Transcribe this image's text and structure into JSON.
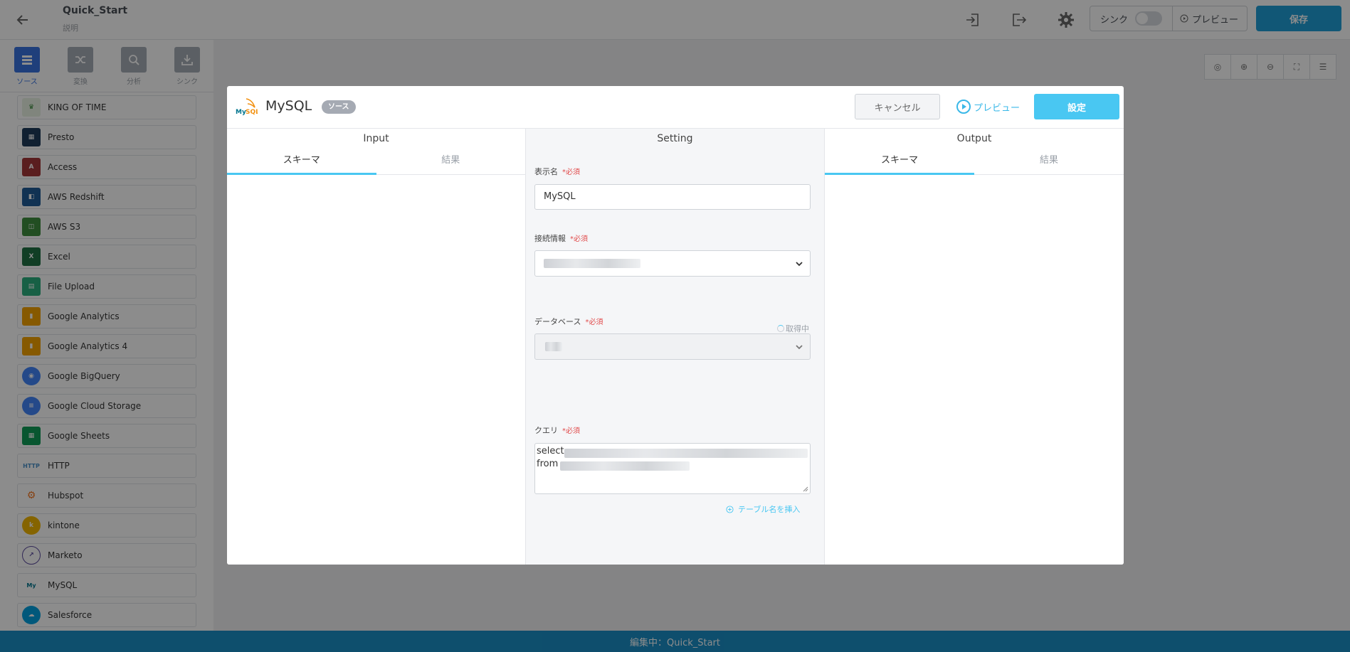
{
  "app": {
    "project_title": "Quick_Start",
    "project_subtitle": "説明",
    "sync_label": "シンク",
    "preview_label": "プレビュー",
    "save_label": "保存",
    "status_text": "編集中：Quick_Start"
  },
  "left_tabs": [
    {
      "label": "ソース",
      "icon": "table-icon",
      "active": true
    },
    {
      "label": "変換",
      "icon": "shuffle-icon",
      "active": false
    },
    {
      "label": "分析",
      "icon": "analysis-icon",
      "active": false
    },
    {
      "label": "シンク",
      "icon": "sink-icon",
      "active": false
    }
  ],
  "connectors": [
    {
      "name": "KING OF TIME",
      "icon": "king-of-time-icon",
      "color": "#e9f2e4"
    },
    {
      "name": "Presto",
      "icon": "presto-icon",
      "color": "#1e3b5a"
    },
    {
      "name": "Access",
      "icon": "access-icon",
      "color": "#a4373a"
    },
    {
      "name": "AWS Redshift",
      "icon": "redshift-icon",
      "color": "#205b98"
    },
    {
      "name": "AWS S3",
      "icon": "s3-icon",
      "color": "#3e8e3e"
    },
    {
      "name": "Excel",
      "icon": "excel-icon",
      "color": "#1f7244"
    },
    {
      "name": "File Upload",
      "icon": "file-upload-icon",
      "color": "#2bb07f"
    },
    {
      "name": "Google Analytics",
      "icon": "google-analytics-icon",
      "color": "#f4a300"
    },
    {
      "name": "Google Analytics 4",
      "icon": "google-analytics-4-icon",
      "color": "#f4a300"
    },
    {
      "name": "Google BigQuery",
      "icon": "bigquery-icon",
      "color": "#4386fa"
    },
    {
      "name": "Google Cloud Storage",
      "icon": "cloud-storage-icon",
      "color": "#4386fa"
    },
    {
      "name": "Google Sheets",
      "icon": "sheets-icon",
      "color": "#0f9d58"
    },
    {
      "name": "HTTP",
      "icon": "http-icon",
      "color": "#4a90c8"
    },
    {
      "name": "Hubspot",
      "icon": "hubspot-icon",
      "color": "#f57722"
    },
    {
      "name": "kintone",
      "icon": "kintone-icon",
      "color": "#f2b600"
    },
    {
      "name": "Marketo",
      "icon": "marketo-icon",
      "color": "#5c4c9f"
    },
    {
      "name": "MySQL",
      "icon": "mysql-icon",
      "color": "#00758f"
    },
    {
      "name": "Salesforce",
      "icon": "salesforce-icon",
      "color": "#00a1e0"
    }
  ],
  "modal": {
    "title": "MySQL",
    "badge": "ソース",
    "cancel_label": "キャンセル",
    "preview_label": "プレビュー",
    "set_label": "設定",
    "input": {
      "heading": "Input",
      "tabs": [
        "スキーマ",
        "結果"
      ]
    },
    "setting": {
      "heading": "Setting",
      "display_name_label": "表示名",
      "display_name_value": "MySQL",
      "connection_label": "接続情報",
      "loading_text": "取得中",
      "database_label": "データベース",
      "query_label": "クエリ",
      "query_lines": [
        "select",
        "from"
      ],
      "required_mark": "*必須",
      "insert_table_label": "テーブル名を挿入"
    },
    "output": {
      "heading": "Output",
      "tabs": [
        "スキーマ",
        "結果"
      ]
    }
  },
  "colors": {
    "accent": "#49c7f2",
    "save": "#1f9fd8",
    "status_bar": "#1a8fc6",
    "required": "#e14b4b"
  }
}
